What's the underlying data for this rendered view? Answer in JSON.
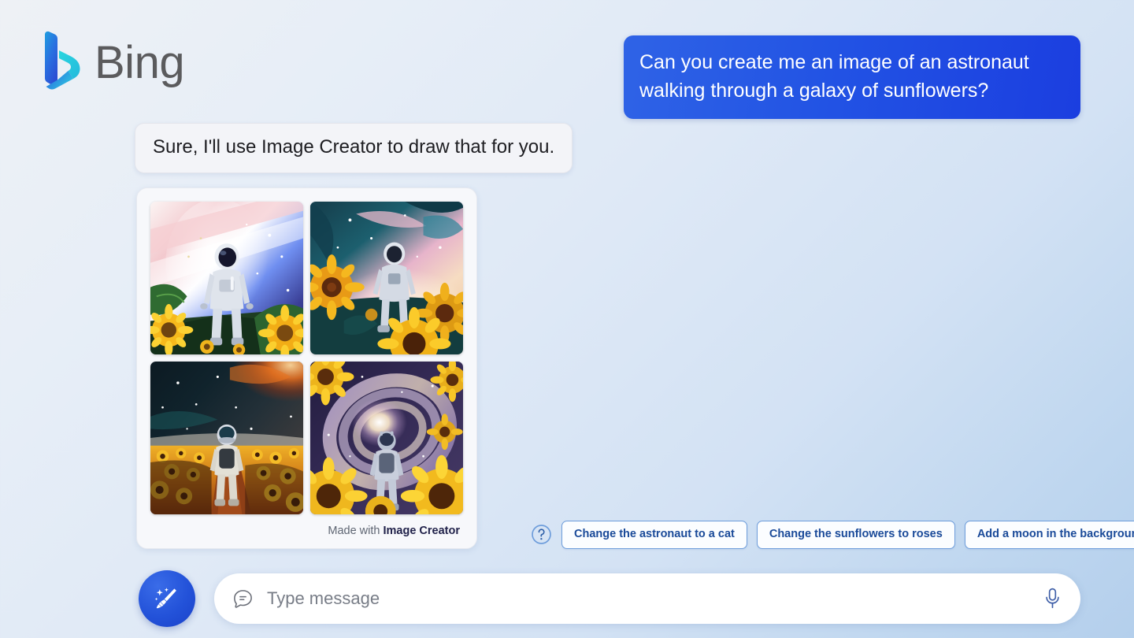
{
  "brand": {
    "name": "Bing",
    "logo_icon": "bing-logo-icon",
    "accent_blue": "#1b3ee0",
    "logo_gradient_start": "#37aee2",
    "logo_gradient_end": "#2553d8"
  },
  "background": {
    "gradient_start": "#eef1f5",
    "gradient_end": "#b4cfec"
  },
  "conversation": {
    "user_message": {
      "text": "Can you create me an image of an astronaut walking through a galaxy of sunflowers?",
      "bubble_color": "#2253e4",
      "text_color": "#ffffff"
    },
    "assistant_message": {
      "text": "Sure, I'll use Image Creator to draw that for you.",
      "bubble_color": "#f3f4f8",
      "text_color": "#1d1d21"
    },
    "image_card": {
      "caption_prefix": "Made with",
      "caption_link": "Image Creator",
      "images": [
        {
          "alt": "Astronaut standing among sunflower leaves facing a bright blue and pink galaxy",
          "palette": [
            "#f3eef0",
            "#f0c4cc",
            "#8fa6f0",
            "#2b2f6e",
            "#2f6b31",
            "#f2b723"
          ]
        },
        {
          "alt": "Astronaut walking away through sunflowers under a teal and pink nebula",
          "palette": [
            "#184a55",
            "#e8b7cd",
            "#f4d9bb",
            "#1c3a44",
            "#f6b81c",
            "#b87312"
          ]
        },
        {
          "alt": "Astronaut walking down a path in a sunflower field beneath an orange galaxy",
          "palette": [
            "#101a22",
            "#e0631f",
            "#f0a21a",
            "#27343a",
            "#d7d2c6",
            "#6b2c10"
          ]
        },
        {
          "alt": "Astronaut walking toward a spiral galaxy framed by large sunflowers",
          "palette": [
            "#2b2447",
            "#b7a6d8",
            "#f7f0e4",
            "#f6c31b",
            "#8a6fb5",
            "#3d3360"
          ]
        }
      ]
    }
  },
  "suggestions": {
    "help_icon": "question-circle-icon",
    "chips": [
      "Change the astronaut to a cat",
      "Change the sunflowers to roses",
      "Add a moon in the background"
    ],
    "chip_border_color": "#6e9ddb",
    "chip_text_color": "#1a4a99"
  },
  "composer": {
    "new_topic_icon": "broom-sparkle-icon",
    "new_topic_label": "New topic",
    "message_icon": "chat-bubble-icon",
    "placeholder": "Type message",
    "value": "",
    "mic_icon": "microphone-icon"
  }
}
